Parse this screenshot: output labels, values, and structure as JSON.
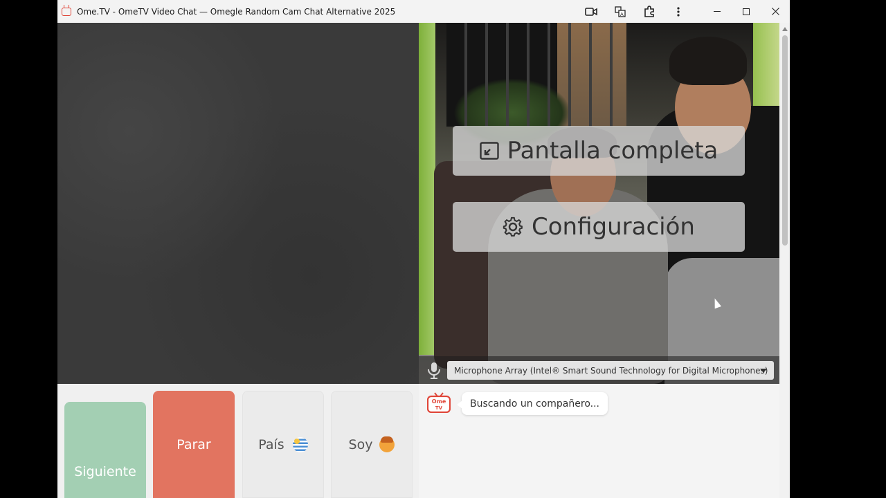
{
  "window": {
    "title": "Ome.TV - OmeTV Video Chat — Omegle Random Cam Chat Alternative 2025",
    "icons": [
      "camera-icon",
      "translate-icon",
      "extension-icon",
      "more-vert-icon"
    ],
    "controls": [
      "minimize-icon",
      "maximize-icon",
      "close-icon"
    ]
  },
  "overlay": {
    "fullscreen_label": "Pantalla completa",
    "config_label": "Configuración"
  },
  "mic": {
    "selected": "Microphone Array (Intel® Smart Sound Technology for Digital Microphones)"
  },
  "controls": {
    "next_label": "Siguiente",
    "stop_label": "Parar",
    "country_label": "País",
    "gender_label": "Soy",
    "colors": {
      "next": "#a3cfb3",
      "stop": "#e27460",
      "neutral": "#ebebeb"
    }
  },
  "chat": {
    "logo_text": "Ome TV",
    "status_message": "Buscando un compañero..."
  }
}
